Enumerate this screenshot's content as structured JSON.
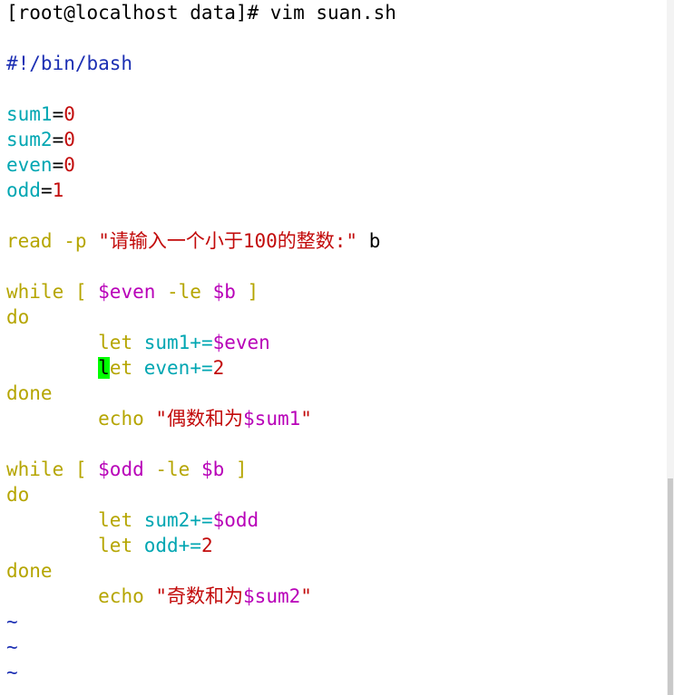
{
  "prompt": "[root@localhost data]# vim suan.sh",
  "shebang": "#!/bin/bash",
  "vars": [
    {
      "name": "sum1",
      "eq": "=",
      "value": "0"
    },
    {
      "name": "sum2",
      "eq": "=",
      "value": "0"
    },
    {
      "name": "even",
      "eq": "=",
      "value": "0"
    },
    {
      "name": "odd",
      "eq": "=",
      "value": "1"
    }
  ],
  "read_line": {
    "cmd": "read",
    "opt": "-p",
    "str": "\"请输入一个小于",
    "num": "100",
    "str2": "的整数:\"",
    "arg": " b"
  },
  "loop1": {
    "kw_while": "while",
    "lb": " [ ",
    "var": "$even",
    "op": " -le ",
    "var2": "$b",
    "rb": " ]",
    "kw_do": "do",
    "l1_let": "let",
    "l1_var": " sum1+=",
    "l1_val": "$even",
    "l2_cursor": "l",
    "l2_let": "et",
    "l2_var": " even+=",
    "l2_val": "2",
    "kw_done": "done",
    "echo": "echo",
    "echo_str": " \"偶数和为",
    "echo_var": "$sum1",
    "echo_end": "\""
  },
  "loop2": {
    "kw_while": "while",
    "lb": " [ ",
    "var": "$odd",
    "op": " -le ",
    "var2": "$b",
    "rb": " ]",
    "kw_do": "do",
    "l1_let": "let",
    "l1_var": " sum2+=",
    "l1_val": "$odd",
    "l2_let": "let",
    "l2_var": " odd+=",
    "l2_val": "2",
    "kw_done": "done",
    "echo": "echo",
    "echo_str": " \"奇数和为",
    "echo_var": "$sum2",
    "echo_end": "\""
  },
  "tildes": [
    "~",
    "~",
    "~"
  ],
  "indent": "        ",
  "colors": {
    "keyword": "#b5a500",
    "variable": "#00a6b2",
    "number": "#c20a0a",
    "reference": "#b800b8",
    "comment": "#1c2fb3",
    "cursor": "#00ff00"
  }
}
